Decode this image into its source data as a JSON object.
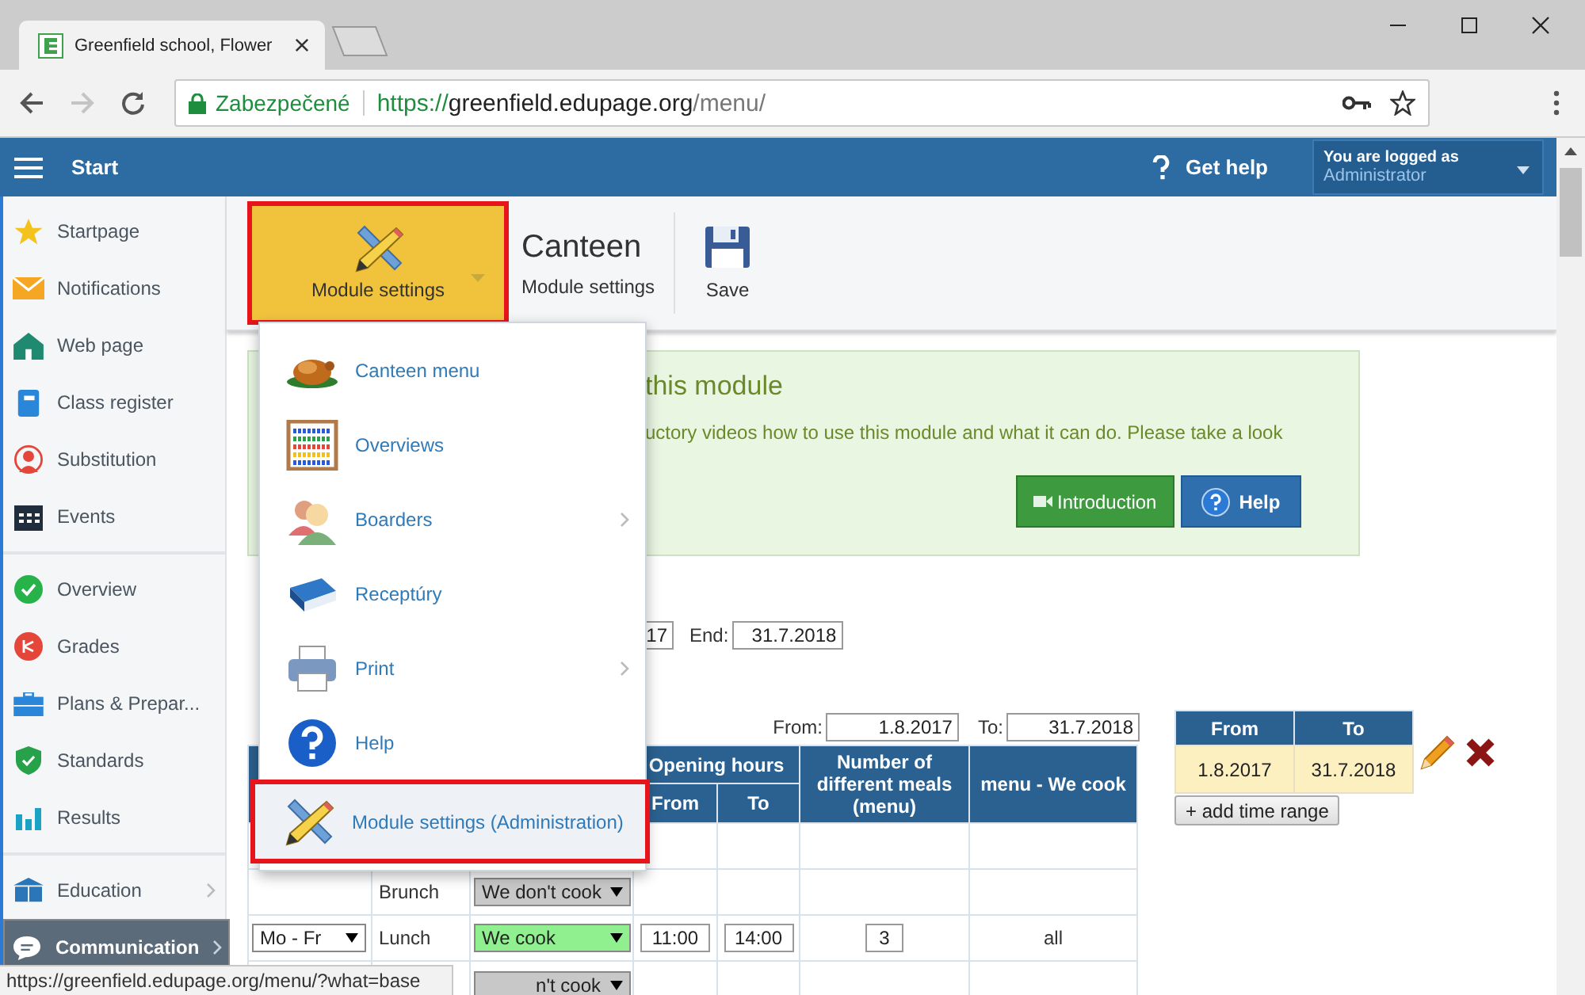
{
  "browser": {
    "tab": {
      "title": "Greenfield school, Flower"
    },
    "address": {
      "security": "Zabezpečené",
      "scheme": "https://",
      "host": "greenfield.edupage.org",
      "path": "/menu/"
    },
    "status_url": "https://greenfield.edupage.org/menu/?what=base"
  },
  "header": {
    "title": "Start",
    "help": "Get help",
    "login_label": "You are logged as",
    "user": "Administrator"
  },
  "sidebar": {
    "groups": [
      [
        {
          "label": "Startpage",
          "selected": false,
          "has_submenu": false
        },
        {
          "label": "Notifications",
          "selected": false,
          "has_submenu": false
        },
        {
          "label": "Web page",
          "selected": false,
          "has_submenu": false
        },
        {
          "label": "Class register",
          "selected": false,
          "has_submenu": false
        },
        {
          "label": "Substitution",
          "selected": false,
          "has_submenu": false
        },
        {
          "label": "Events",
          "selected": false,
          "has_submenu": false
        }
      ],
      [
        {
          "label": "Overview",
          "selected": false,
          "has_submenu": false
        },
        {
          "label": "Grades",
          "selected": false,
          "has_submenu": false
        },
        {
          "label": "Plans & Prepar...",
          "selected": false,
          "has_submenu": false
        },
        {
          "label": "Standards",
          "selected": false,
          "has_submenu": false
        },
        {
          "label": "Results",
          "selected": false,
          "has_submenu": false
        }
      ],
      [
        {
          "label": "Education",
          "selected": false,
          "has_submenu": true
        },
        {
          "label": "Communication",
          "selected": true,
          "has_submenu": true
        }
      ]
    ]
  },
  "toolbar": {
    "module_button": {
      "label": "Module settings",
      "expanded": true
    },
    "title": "Canteen",
    "subtitle": "Module settings",
    "save": "Save"
  },
  "dropdown": {
    "items": [
      {
        "label": "Canteen menu",
        "has_submenu": false,
        "selected": false
      },
      {
        "label": "Overviews",
        "has_submenu": false,
        "selected": false
      },
      {
        "label": "Boarders",
        "has_submenu": true,
        "selected": false
      },
      {
        "label": "Receptúry",
        "has_submenu": false,
        "selected": false
      },
      {
        "label": "Print",
        "has_submenu": true,
        "selected": false
      },
      {
        "label": "Help",
        "has_submenu": false,
        "selected": false
      },
      {
        "label": "Module settings (Administration)",
        "has_submenu": false,
        "selected": true
      }
    ]
  },
  "intro": {
    "heading": "this module",
    "text": "uctory videos how to use this module and what it can do. Please take a look",
    "intro_button": "Introduction",
    "help_button": "Help"
  },
  "settings": {
    "start_value": "17",
    "end_label": "End:",
    "end_value": "31.7.2018"
  },
  "range": {
    "from_label": "From:",
    "from": "1.8.2017",
    "to_label": "To:",
    "to": "31.7.2018"
  },
  "table": {
    "columns": {
      "opening_hours": "Opening hours",
      "from": "From",
      "to": "To",
      "meals": "Number of different meals (menu)",
      "menu": "menu - We cook"
    },
    "rows": [
      {},
      {
        "meal": "Brunch",
        "cooking": false,
        "status": "We don't cook"
      },
      {
        "days": "Mo - Fr",
        "meal": "Lunch",
        "cooking": true,
        "status": "We cook",
        "from": "11:00",
        "to": "14:00",
        "meals": "3",
        "menu": "all"
      },
      {
        "cooking": false,
        "status": "n't cook"
      }
    ]
  },
  "ranges": {
    "columns": [
      "From",
      "To"
    ],
    "rows": [
      {
        "from": "1.8.2017",
        "to": "31.7.2018"
      }
    ],
    "add_button": "+ add time range"
  }
}
